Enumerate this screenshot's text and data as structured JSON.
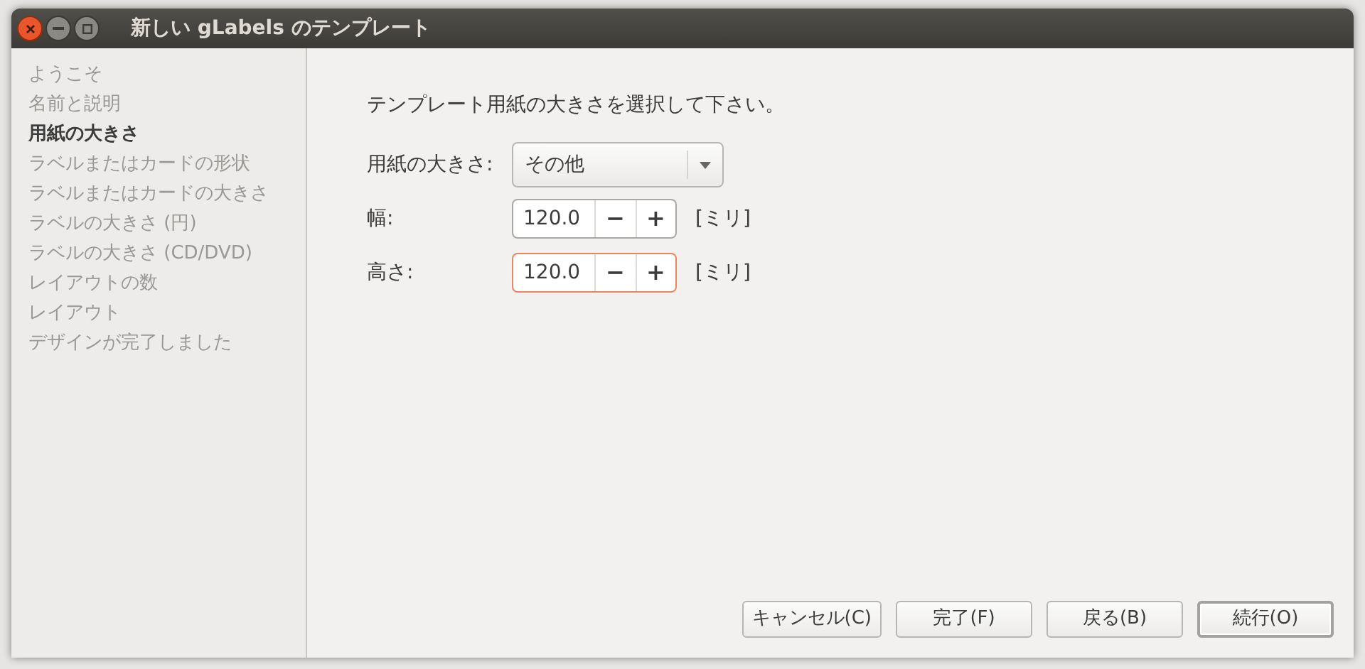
{
  "window": {
    "title": "新しい gLabels のテンプレート"
  },
  "sidebar": {
    "items": [
      {
        "label": "ようこそ",
        "selected": false
      },
      {
        "label": "名前と説明",
        "selected": false
      },
      {
        "label": "用紙の大きさ",
        "selected": true
      },
      {
        "label": "ラベルまたはカードの形状",
        "selected": false
      },
      {
        "label": "ラベルまたはカードの大きさ",
        "selected": false
      },
      {
        "label": "ラベルの大きさ (円)",
        "selected": false
      },
      {
        "label": "ラベルの大きさ (CD/DVD)",
        "selected": false
      },
      {
        "label": "レイアウトの数",
        "selected": false
      },
      {
        "label": "レイアウト",
        "selected": false
      },
      {
        "label": "デザインが完了しました",
        "selected": false
      }
    ]
  },
  "content": {
    "instruction": "テンプレート用紙の大きさを選択して下さい。",
    "fields": [
      {
        "kind": "dropdown",
        "label": "用紙の大きさ:",
        "value": "その他"
      },
      {
        "kind": "spin",
        "label": "幅:",
        "value": "120.0",
        "minus": "−",
        "plus": "+",
        "unit": "[ミリ]",
        "focused": false
      },
      {
        "kind": "spin",
        "label": "高さ:",
        "value": "120.0",
        "minus": "−",
        "plus": "+",
        "unit": "[ミリ]",
        "focused": true
      }
    ]
  },
  "buttons": [
    {
      "label": "キャンセル(C)",
      "default": false
    },
    {
      "label": "完了(F)",
      "default": false
    },
    {
      "label": "戻る(B)",
      "default": false
    },
    {
      "label": "続行(O)",
      "default": true
    }
  ]
}
